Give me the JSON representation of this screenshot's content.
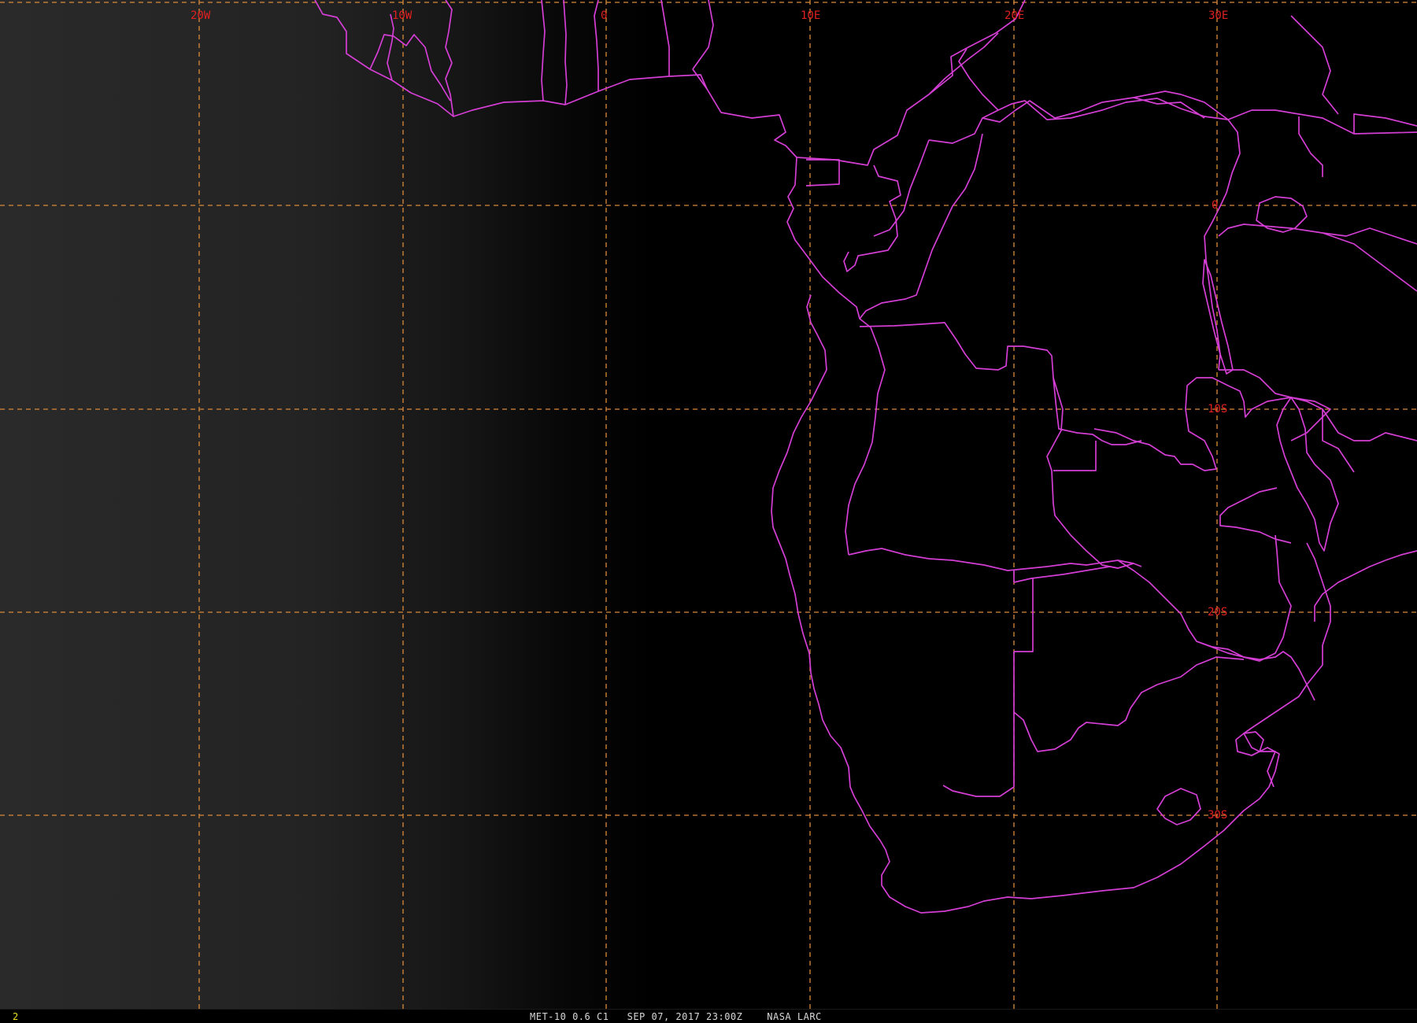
{
  "map": {
    "grid_labels": {
      "lon_20w": "20W",
      "lon_10w": "10W",
      "lon_0": "0",
      "lon_10e": "10E",
      "lon_20e": "20E",
      "lon_30e": "30E",
      "lat_0": "0",
      "lat_10s": "10S",
      "lat_20s": "20S",
      "lat_30s": "30S"
    },
    "colors": {
      "grid": "#d98a3a",
      "borders": "#d43ed4",
      "labels": "#e02020"
    }
  },
  "status_bar": {
    "frame_number": "2",
    "caption": "MET-10 0.6 C1   SEP 07, 2017 23:00Z    NASA LARC"
  }
}
